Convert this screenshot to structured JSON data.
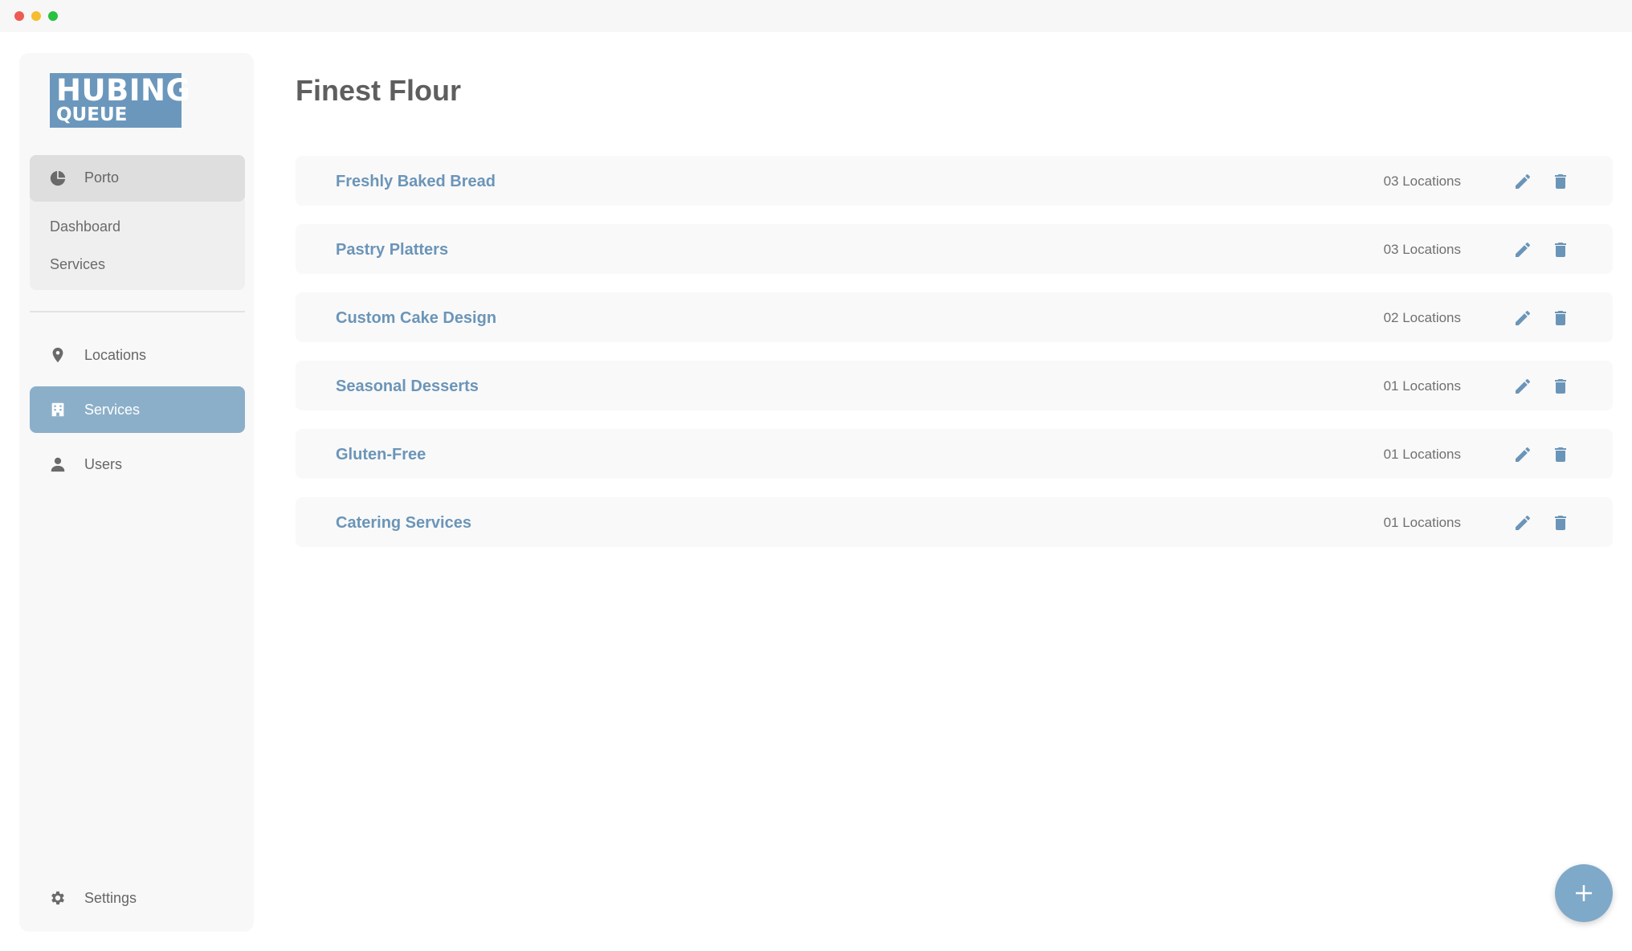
{
  "brand": {
    "line1": "HUBING",
    "line2": "QUEUE",
    "color": "#6b97bc"
  },
  "sidebar": {
    "group": {
      "title": "Porto",
      "icon": "pie-chart-icon",
      "items": [
        {
          "label": "Dashboard"
        },
        {
          "label": "Services"
        }
      ]
    },
    "nav": [
      {
        "label": "Locations",
        "icon": "map-pin-icon",
        "active": false
      },
      {
        "label": "Services",
        "icon": "store-icon",
        "active": true
      },
      {
        "label": "Users",
        "icon": "user-icon",
        "active": false
      }
    ],
    "settings": {
      "label": "Settings",
      "icon": "gear-icon"
    }
  },
  "main": {
    "title": "Finest Flour",
    "services": [
      {
        "name": "Freshly Baked Bread",
        "locations": "03 Locations"
      },
      {
        "name": "Pastry Platters",
        "locations": "03 Locations"
      },
      {
        "name": "Custom Cake Design",
        "locations": "02 Locations"
      },
      {
        "name": "Seasonal Desserts",
        "locations": "01 Locations"
      },
      {
        "name": "Gluten-Free",
        "locations": "01 Locations"
      },
      {
        "name": "Catering Services",
        "locations": "01 Locations"
      }
    ]
  },
  "colors": {
    "accent": "#6b95b8",
    "active_nav": "#8cafc9",
    "fab": "#7fa9c9"
  }
}
